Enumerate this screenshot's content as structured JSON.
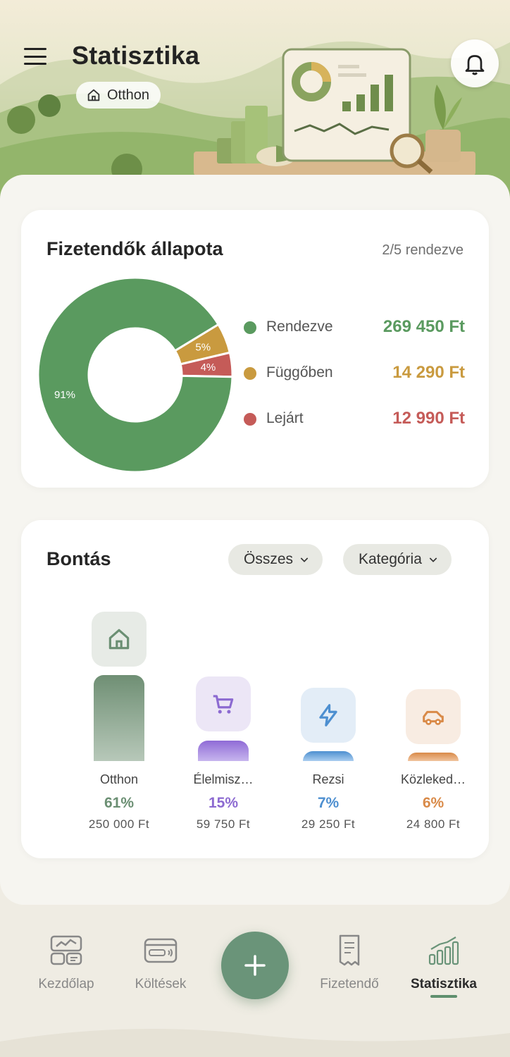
{
  "header": {
    "title": "Statisztika",
    "context_chip": "Otthon",
    "menu_icon": "hamburger-menu-icon",
    "notification_icon": "bell-icon"
  },
  "status_card": {
    "title": "Fizetendők állapota",
    "count": "2/5 rendezve",
    "legend": [
      {
        "label": "Rendezve",
        "amount": "269 450 Ft",
        "color": "#5a9a5f"
      },
      {
        "label": "Függőben",
        "amount": "14 290 Ft",
        "color": "#c99a3f"
      },
      {
        "label": "Lejárt",
        "amount": "12 990 Ft",
        "color": "#c55b58"
      }
    ],
    "slice_labels": [
      "91%",
      "5%",
      "4%"
    ]
  },
  "chart_data": {
    "type": "pie",
    "categories": [
      "Rendezve",
      "Függőben",
      "Lejárt"
    ],
    "values": [
      91,
      5,
      4
    ],
    "colors": [
      "#5a9a5f",
      "#c99a3f",
      "#c55b58"
    ],
    "donut": true
  },
  "breakdown_card": {
    "title": "Bontás",
    "filter_period": "Összes",
    "filter_group": "Kategória",
    "categories": [
      {
        "name": "Otthon",
        "percent": "61%",
        "amount": "250 000 Ft",
        "share": 0.61,
        "icon": "home-icon",
        "color": "#6b8f73"
      },
      {
        "name": "Élelmisz…",
        "percent": "15%",
        "amount": "59 750 Ft",
        "share": 0.15,
        "icon": "shopping-cart-icon",
        "color": "#8c6ad1"
      },
      {
        "name": "Rezsi",
        "percent": "7%",
        "amount": "29 250 Ft",
        "share": 0.07,
        "icon": "lightning-icon",
        "color": "#4d8fd0"
      },
      {
        "name": "Közleked…",
        "percent": "6%",
        "amount": "24 800 Ft",
        "share": 0.06,
        "icon": "car-icon",
        "color": "#d98a48"
      }
    ]
  },
  "nav": {
    "items": [
      {
        "label": "Kezdőlap",
        "icon": "dashboard-icon"
      },
      {
        "label": "Költések",
        "icon": "card-icon"
      },
      {
        "label": "Fizetendő",
        "icon": "receipt-icon"
      },
      {
        "label": "Statisztika",
        "icon": "bar-chart-icon"
      }
    ],
    "add_icon": "plus-icon"
  }
}
